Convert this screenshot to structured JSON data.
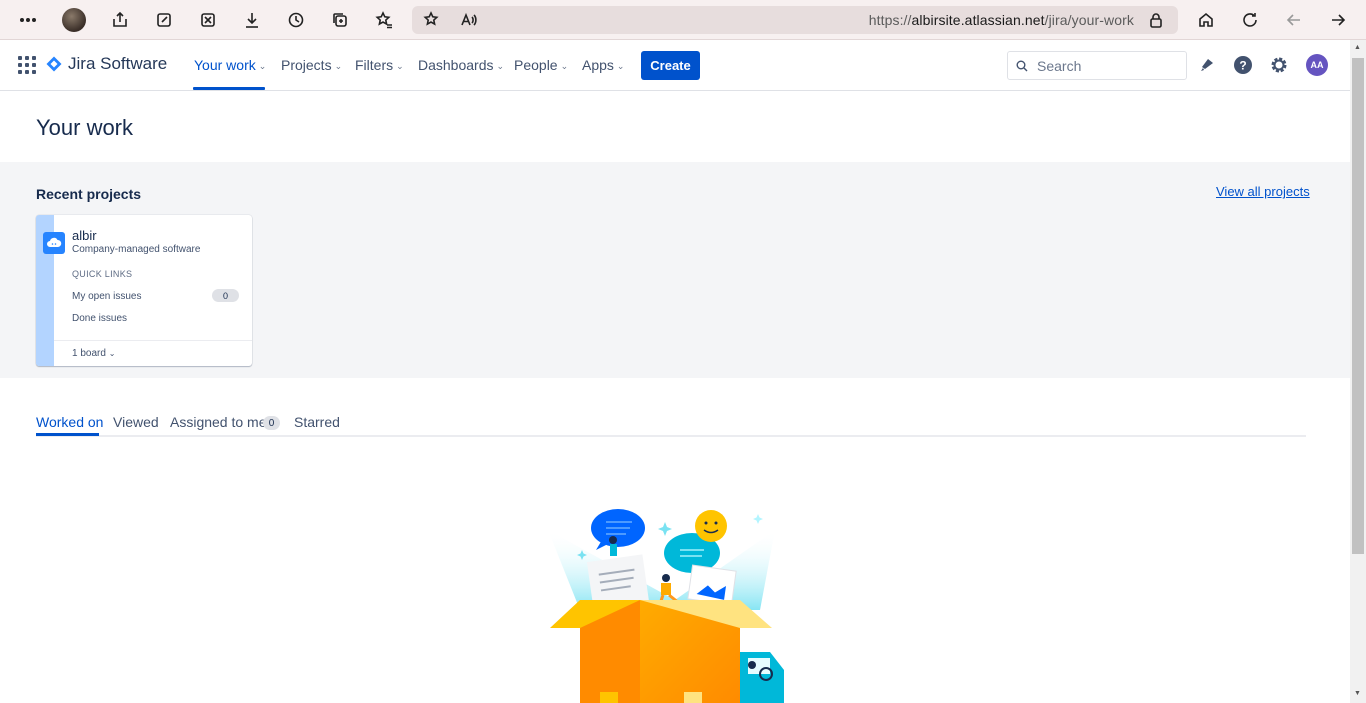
{
  "browser": {
    "url_prefix": "https://",
    "url_host": "albirsite.atlassian.net",
    "url_path": "/jira/your-work"
  },
  "nav": {
    "product": "Jira Software",
    "items": [
      {
        "label": "Your work",
        "active": true
      },
      {
        "label": "Projects"
      },
      {
        "label": "Filters"
      },
      {
        "label": "Dashboards"
      },
      {
        "label": "People"
      },
      {
        "label": "Apps"
      }
    ],
    "create_label": "Create",
    "search_placeholder": "Search",
    "user_initials": "AA"
  },
  "page": {
    "title": "Your work",
    "recent_projects_title": "Recent projects",
    "view_all_label": "View all projects"
  },
  "project_card": {
    "name": "albir",
    "type": "Company-managed software",
    "quick_links_title": "QUICK LINKS",
    "open_issues_label": "My open issues",
    "open_issues_count": "0",
    "done_issues_label": "Done issues",
    "board_label": "1 board"
  },
  "tabs": {
    "worked_on": "Worked on",
    "viewed": "Viewed",
    "assigned": "Assigned to me",
    "assigned_count": "0",
    "starred": "Starred"
  },
  "colors": {
    "brand": "#0052CC",
    "card_stripe": "#B3D4FF",
    "avatar": "#6554C0"
  }
}
